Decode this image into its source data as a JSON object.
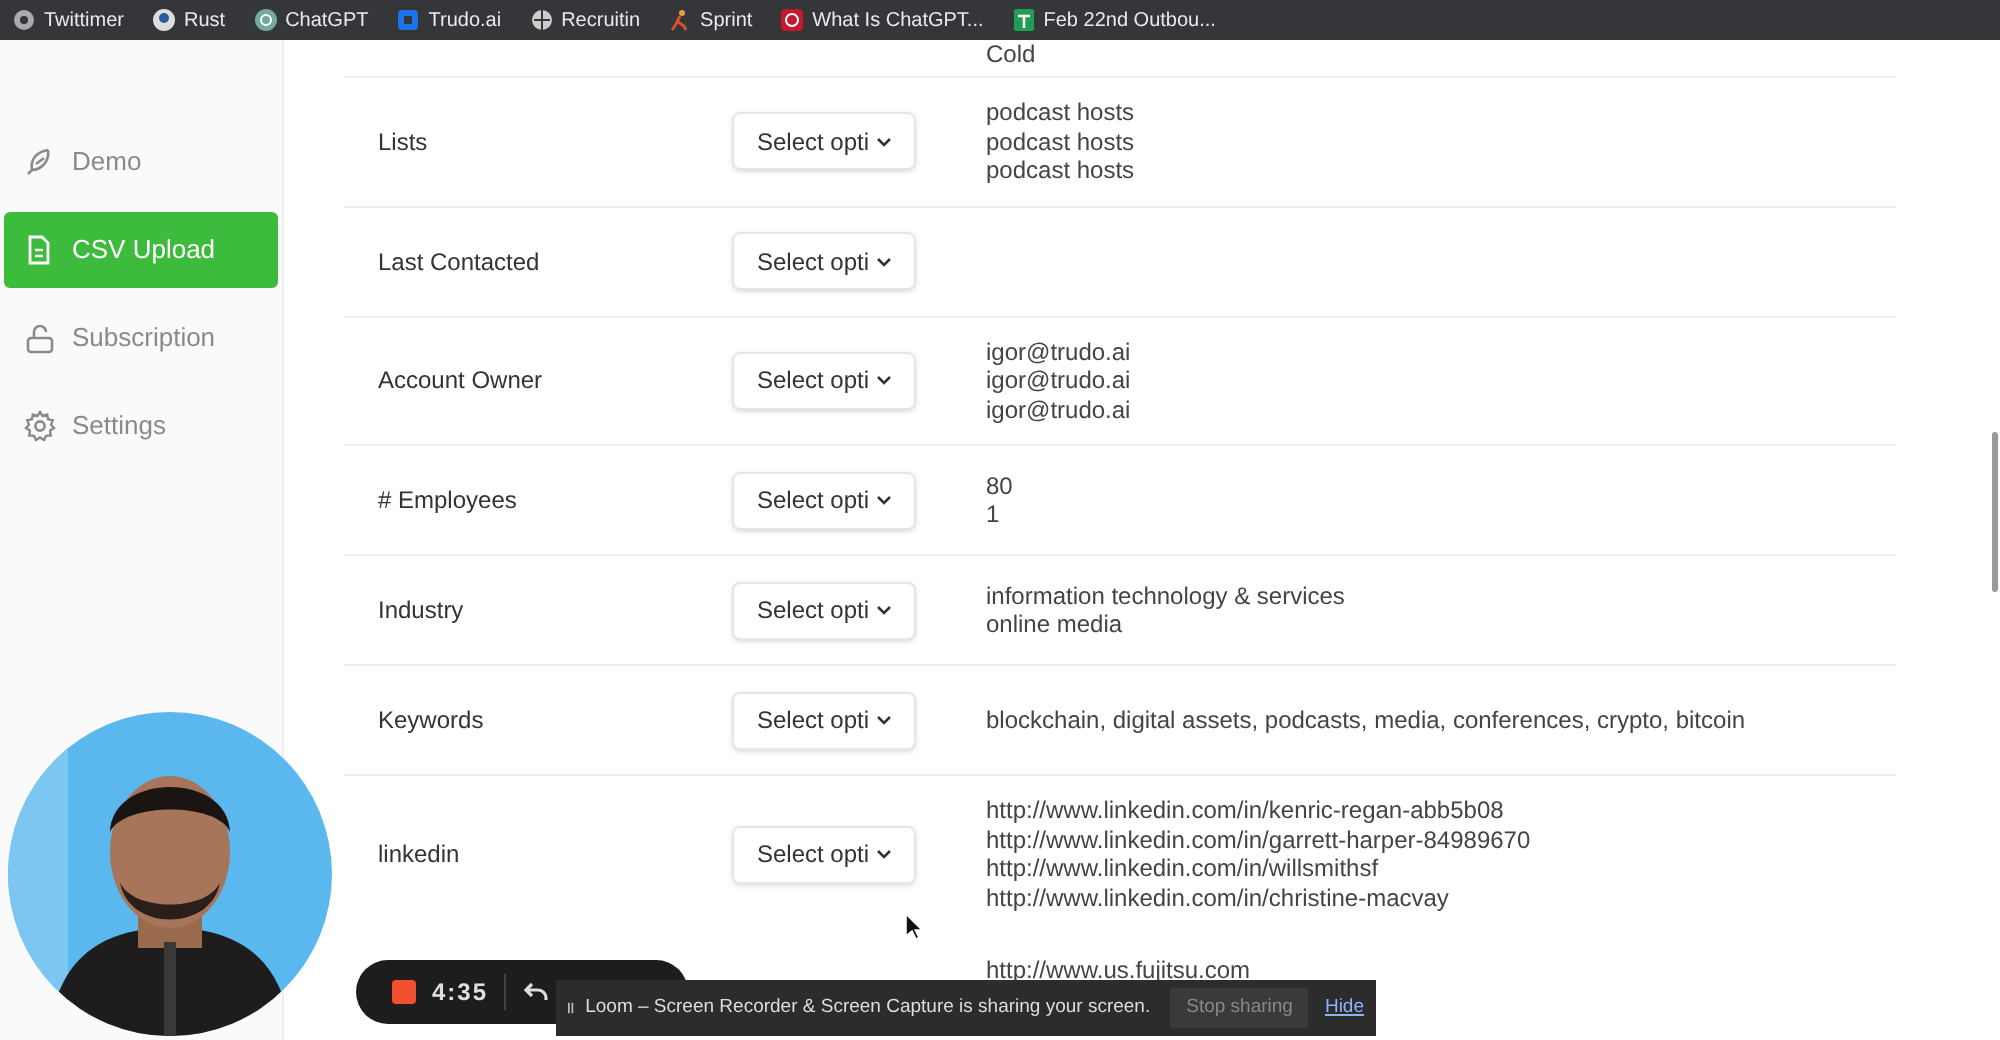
{
  "bookmarks": [
    {
      "label": "Twittimer"
    },
    {
      "label": "Rust"
    },
    {
      "label": "ChatGPT"
    },
    {
      "label": "Trudo.ai"
    },
    {
      "label": "Recruitin"
    },
    {
      "label": "Sprint"
    },
    {
      "label": "What Is ChatGPT..."
    },
    {
      "label": "Feb 22nd Outbou..."
    }
  ],
  "sidebar": {
    "items": [
      {
        "label": "Demo",
        "selected": false
      },
      {
        "label": "CSV Upload",
        "selected": true
      },
      {
        "label": "Subscription",
        "selected": false
      },
      {
        "label": "Settings",
        "selected": false
      }
    ]
  },
  "rows": [
    {
      "kind": "partial",
      "values": [
        "Cold"
      ]
    },
    {
      "kind": "field",
      "label": "Lists",
      "select": "Select opti",
      "values": [
        "podcast hosts",
        "podcast hosts",
        "podcast hosts"
      ]
    },
    {
      "kind": "field",
      "label": "Last Contacted",
      "select": "Select opti",
      "values": []
    },
    {
      "kind": "field",
      "label": "Account Owner",
      "select": "Select opti",
      "values": [
        "igor@trudo.ai",
        "igor@trudo.ai",
        "igor@trudo.ai"
      ]
    },
    {
      "kind": "field",
      "label": "# Employees",
      "select": "Select opti",
      "values": [
        "80",
        "1"
      ]
    },
    {
      "kind": "field",
      "label": "Industry",
      "select": "Select opti",
      "values": [
        "information technology & services",
        "online media"
      ]
    },
    {
      "kind": "field",
      "label": "Keywords",
      "select": "Select opti",
      "values": [
        "blockchain, digital assets, podcasts, media, conferences, crypto, bitcoin"
      ]
    },
    {
      "kind": "field",
      "label": "linkedin",
      "select": "Select opti",
      "values": [
        "http://www.linkedin.com/in/kenric-regan-abb5b08",
        "http://www.linkedin.com/in/garrett-harper-84989670",
        "http://www.linkedin.com/in/willsmithsf",
        "http://www.linkedin.com/in/christine-macvay"
      ]
    },
    {
      "kind": "partial",
      "values": [
        "http://www.us.fujitsu.com"
      ]
    }
  ],
  "recorder": {
    "time": "4:35"
  },
  "sharing_banner": {
    "message": "Loom – Screen Recorder & Screen Capture is sharing your screen.",
    "stop_button": "Stop sharing",
    "hide_link": "Hide"
  }
}
